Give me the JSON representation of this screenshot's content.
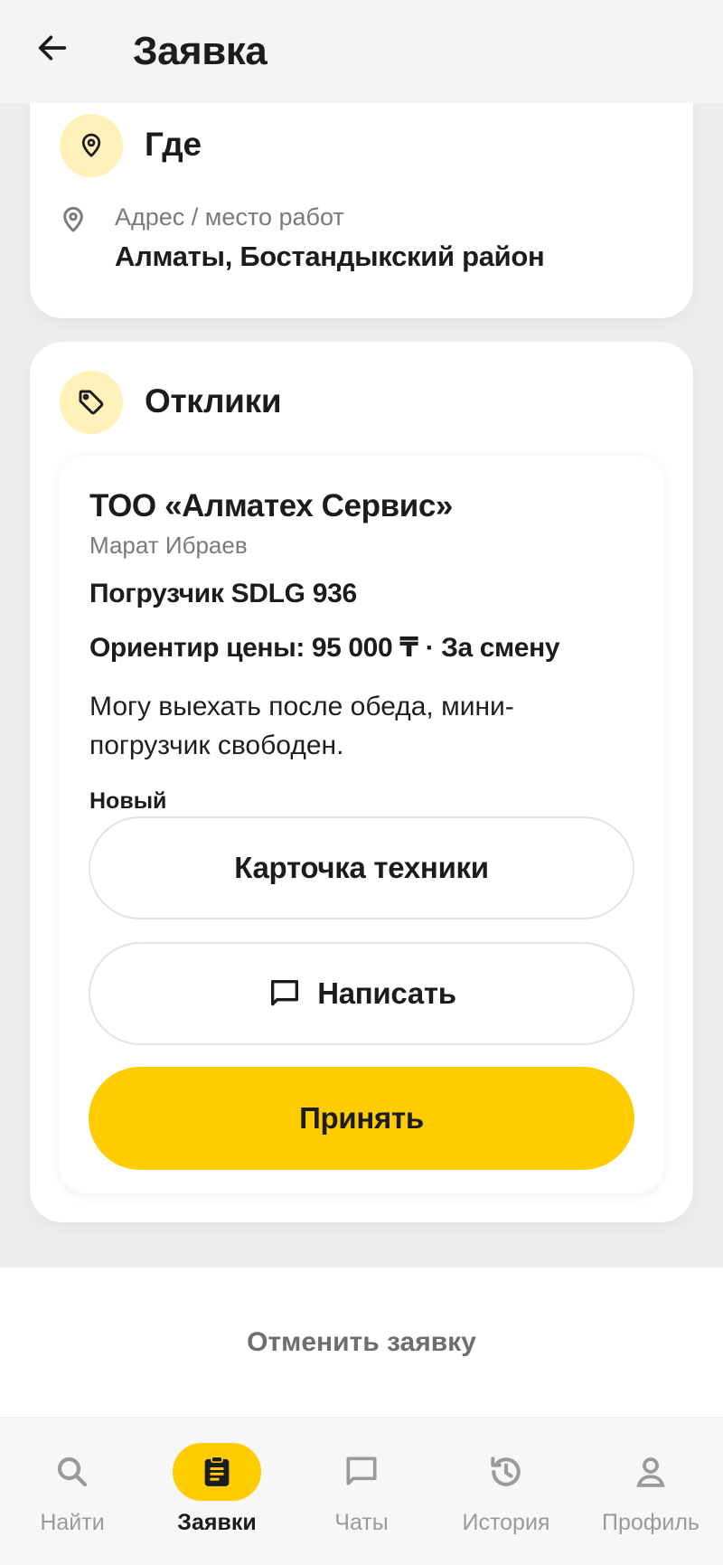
{
  "header": {
    "title": "Заявка",
    "back_icon": "arrow-left-icon"
  },
  "where": {
    "title": "Где",
    "address_label": "Адрес / место работ",
    "address_value": "Алматы, Бостандыкский район"
  },
  "responses": {
    "title": "Отклики",
    "items": [
      {
        "company": "ТОО «Алматех Сервис»",
        "person": "Марат Ибраев",
        "machine": "Погрузчик SDLG 936",
        "price": "Ориентир цены: 95 000 ₸ · За смену",
        "message": "Могу выехать после обеда, мини-погрузчик свободен.",
        "status": "Новый",
        "btn_card": "Карточка техники",
        "btn_write": "Написать",
        "btn_accept": "Принять"
      }
    ]
  },
  "cancel_label": "Отменить заявку",
  "nav": {
    "items": [
      {
        "label": "Найти",
        "icon": "search-icon"
      },
      {
        "label": "Заявки",
        "icon": "clipboard-icon",
        "active": true
      },
      {
        "label": "Чаты",
        "icon": "chat-icon"
      },
      {
        "label": "История",
        "icon": "history-icon"
      },
      {
        "label": "Профиль",
        "icon": "profile-icon"
      }
    ]
  },
  "colors": {
    "accent": "#ffcc00",
    "accent_light": "#fff1b8",
    "background": "#eeeef0"
  }
}
